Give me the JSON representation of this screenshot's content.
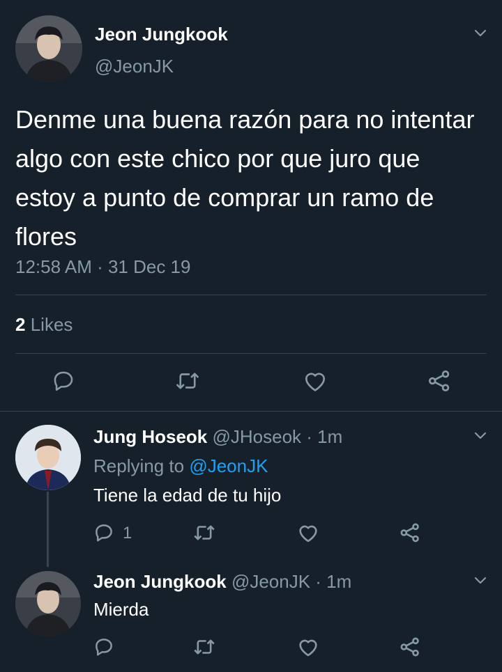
{
  "main_tweet": {
    "display_name": "Jeon Jungkook",
    "handle": "@JeonJK",
    "text": "Denme una buena razón para no intentar algo con este chico por que juro que estoy a punto de comprar un ramo de flores",
    "timestamp": "12:58 AM · 31 Dec 19",
    "likes_count": "2",
    "likes_label": "Likes"
  },
  "reply_1": {
    "display_name": "Jung Hoseok",
    "handle": "@JHoseok",
    "time": "· 1m",
    "replying_prefix": "Replying to",
    "replying_handle": "@JeonJK",
    "text": "Tiene la edad de tu hijo",
    "reply_count": "1"
  },
  "reply_2": {
    "display_name": "Jeon Jungkook",
    "handle": "@JeonJK",
    "time": "· 1m",
    "text": "Mierda"
  },
  "colors": {
    "background": "#15202b",
    "muted": "#8899a6",
    "link": "#1da1f2",
    "divider": "#38444d"
  }
}
